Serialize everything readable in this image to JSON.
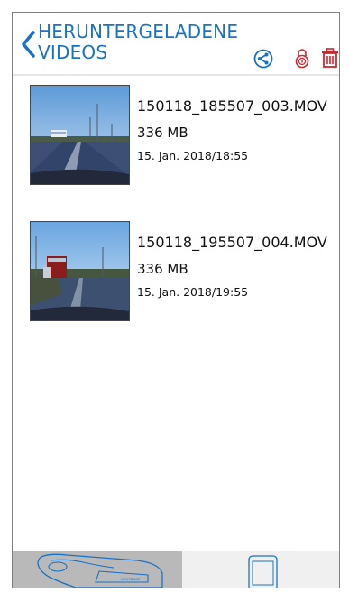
{
  "header": {
    "title_line1": "HERUNTERGELADENE",
    "title_line2": "VIDEOS",
    "icons": [
      "back-chevron-icon",
      "share-icon",
      "lock-icon",
      "trash-icon"
    ]
  },
  "videos": [
    {
      "filename": "150118_185507_003.MOV",
      "size": "336 MB",
      "date": "15. Jan. 2018/18:55"
    },
    {
      "filename": "150118_195507_004.MOV",
      "size": "336 MB",
      "date": "15. Jan. 2018/19:55"
    }
  ],
  "tabbar": {
    "left_icon": "dashcam-icon",
    "right_icon": "phone-icon",
    "dashcam_brand": "NEXTBASE"
  },
  "colors": {
    "accent": "#1a72c4",
    "delete": "#d6232a",
    "active_tab": "#b9b9b9",
    "inactive_tab": "#f0f0f0"
  }
}
